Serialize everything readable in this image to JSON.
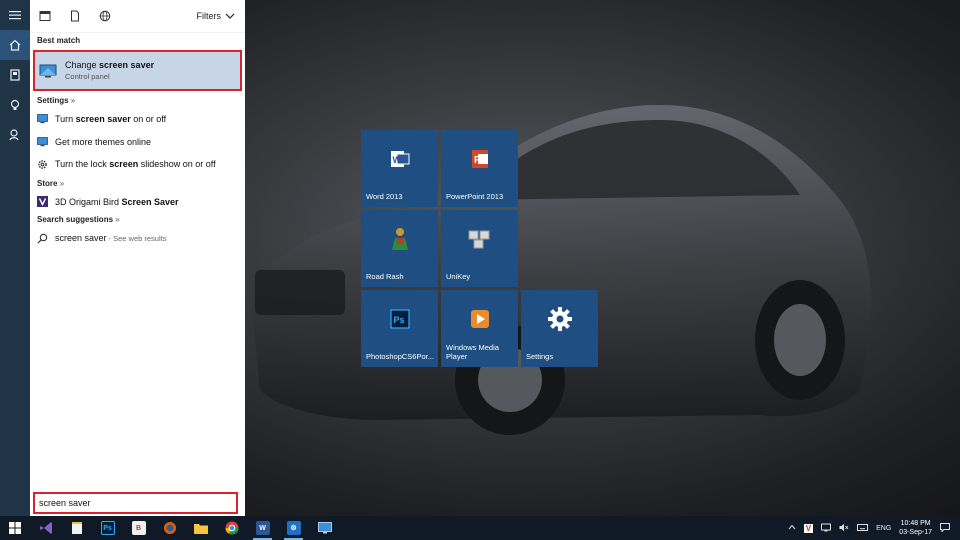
{
  "panel": {
    "header": {
      "filters_label": "Filters"
    },
    "best_match_label": "Best match",
    "best_match": {
      "title_prefix": "Change ",
      "title_bold": "screen saver",
      "subtitle": "Control panel"
    },
    "settings_label": "Settings",
    "settings_items": [
      {
        "prefix": "Turn ",
        "bold": "screen saver",
        "suffix": " on or off",
        "icon": "display-icon"
      },
      {
        "prefix": "Get more themes online",
        "bold": "",
        "suffix": "",
        "icon": "display-icon"
      },
      {
        "prefix": "Turn the lock ",
        "bold": "screen",
        "suffix": " slideshow on or off",
        "icon": "gear-icon"
      }
    ],
    "store_label": "Store",
    "store_items": [
      {
        "prefix": "3D Origami Bird ",
        "bold": "Screen Saver",
        "icon": "store-app-icon"
      }
    ],
    "suggestions_label": "Search suggestions",
    "suggestion": {
      "query": "screen saver",
      "hint": " - See web results"
    },
    "search_value": "screen saver"
  },
  "tiles": [
    {
      "label": "Word 2013",
      "icon": "word-icon",
      "color": "#1f4f82"
    },
    {
      "label": "PowerPoint 2013",
      "icon": "powerpoint-icon",
      "color": "#1f4f82"
    },
    {
      "label": "Road Rash",
      "icon": "road-rash-icon",
      "color": "#1f4f82"
    },
    {
      "label": "UniKey",
      "icon": "unikey-icon",
      "color": "#1f4f82"
    },
    {
      "label": "PhotoshopCS6Por...",
      "icon": "photoshop-icon",
      "color": "#1f4f82"
    },
    {
      "label": "Windows Media Player",
      "icon": "media-player-icon",
      "color": "#1f4f82"
    },
    {
      "label": "Settings",
      "icon": "gear-icon",
      "color": "#1f4f82"
    }
  ],
  "taskbar": {
    "apps": [
      "visual-studio-icon",
      "notepad-icon",
      "photoshop-icon",
      "app-b-icon",
      "firefox-icon",
      "file-explorer-icon",
      "chrome-icon",
      "word-icon",
      "settings-icon",
      "control-panel-icon"
    ],
    "tray": {
      "language": "ENG",
      "time": "10:48 PM",
      "date": "03-Sep-17",
      "unikey_badge": "V"
    }
  },
  "colors": {
    "accent": "#d9232e",
    "tile": "#1f4f82",
    "rail": "#1f3447",
    "selection": "#c6d6e6"
  }
}
